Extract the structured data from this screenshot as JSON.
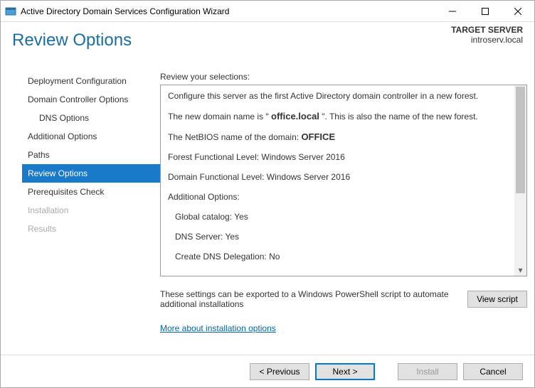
{
  "window": {
    "title": "Active Directory Domain Services Configuration Wizard"
  },
  "header": {
    "title": "Review Options"
  },
  "target": {
    "label": "TARGET SERVER",
    "name": "introserv.local"
  },
  "sidebar": {
    "items": [
      {
        "label": "Deployment Configuration",
        "indent": false,
        "selected": false,
        "disabled": false
      },
      {
        "label": "Domain Controller Options",
        "indent": false,
        "selected": false,
        "disabled": false
      },
      {
        "label": "DNS Options",
        "indent": true,
        "selected": false,
        "disabled": false
      },
      {
        "label": "Additional Options",
        "indent": false,
        "selected": false,
        "disabled": false
      },
      {
        "label": "Paths",
        "indent": false,
        "selected": false,
        "disabled": false
      },
      {
        "label": "Review Options",
        "indent": false,
        "selected": true,
        "disabled": false
      },
      {
        "label": "Prerequisites Check",
        "indent": false,
        "selected": false,
        "disabled": false
      },
      {
        "label": "Installation",
        "indent": false,
        "selected": false,
        "disabled": true
      },
      {
        "label": "Results",
        "indent": false,
        "selected": false,
        "disabled": true
      }
    ]
  },
  "main": {
    "caption": "Review your selections:",
    "review": {
      "line1": "Configure this server as the first Active Directory domain controller in a new forest.",
      "line2a": "The new domain name is \" ",
      "domain": "office.local",
      "line2b": " \". This is also the name of the new forest.",
      "line3a": "The NetBIOS name of the domain: ",
      "netbios": "OFFICE",
      "ffl": "Forest Functional Level: Windows Server 2016",
      "dfl": "Domain Functional Level: Windows Server 2016",
      "addopts": "Additional Options:",
      "gc": "Global catalog: Yes",
      "dns": "DNS Server: Yes",
      "deleg": "Create DNS Delegation: No"
    },
    "export_text": "These settings can be exported to a Windows PowerShell script to automate additional installations",
    "view_script": "View script",
    "more_link": "More about installation options"
  },
  "footer": {
    "previous": "< Previous",
    "next": "Next >",
    "install": "Install",
    "cancel": "Cancel"
  }
}
